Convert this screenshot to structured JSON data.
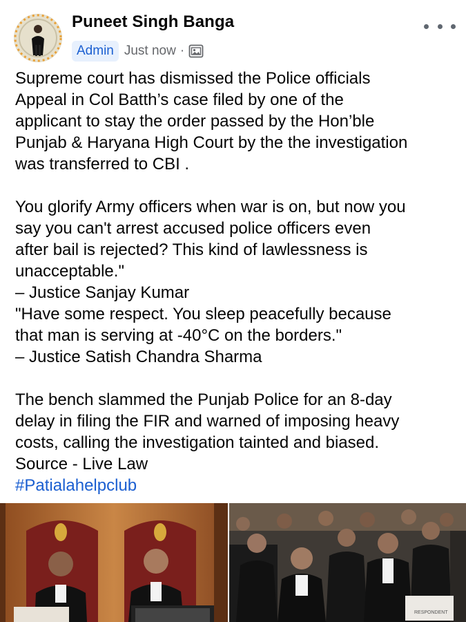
{
  "post": {
    "author": "Puneet Singh Banga",
    "role_badge": "Admin",
    "timestamp": "Just now",
    "separator": "·",
    "audience_icon": "photo-album-icon",
    "more_icon": "more-options-icon",
    "paragraphs": [
      "Supreme court has dismissed the Police officials\nAppeal in Col Batth’s case filed by one of the\napplicant to stay the order passed by the Hon’ble\nPunjab & Haryana High Court by the the investigation\nwas transferred to CBI .",
      "You glorify Army officers when war is on, but now you\nsay you can't arrest accused police officers even\nafter bail is rejected? This kind of lawlessness is\nunacceptable.\"\n– Justice Sanjay Kumar\n\"Have some respect. You sleep peacefully because\nthat man is serving at -40°C on the borders.\"\n– Justice Satish Chandra Sharma",
      "The bench slammed the Punjab Police for an 8-day\ndelay in filing the FIR and warned of imposing heavy\ncosts, calling the investigation tainted and biased.\nSource - Live Law"
    ],
    "hashtag": "#Patialahelpclub",
    "photos": {
      "left_description_icon": "court-bench-photo",
      "right_description_icon": "lawyers-photo",
      "placard_text": "RESPONDENT"
    }
  }
}
